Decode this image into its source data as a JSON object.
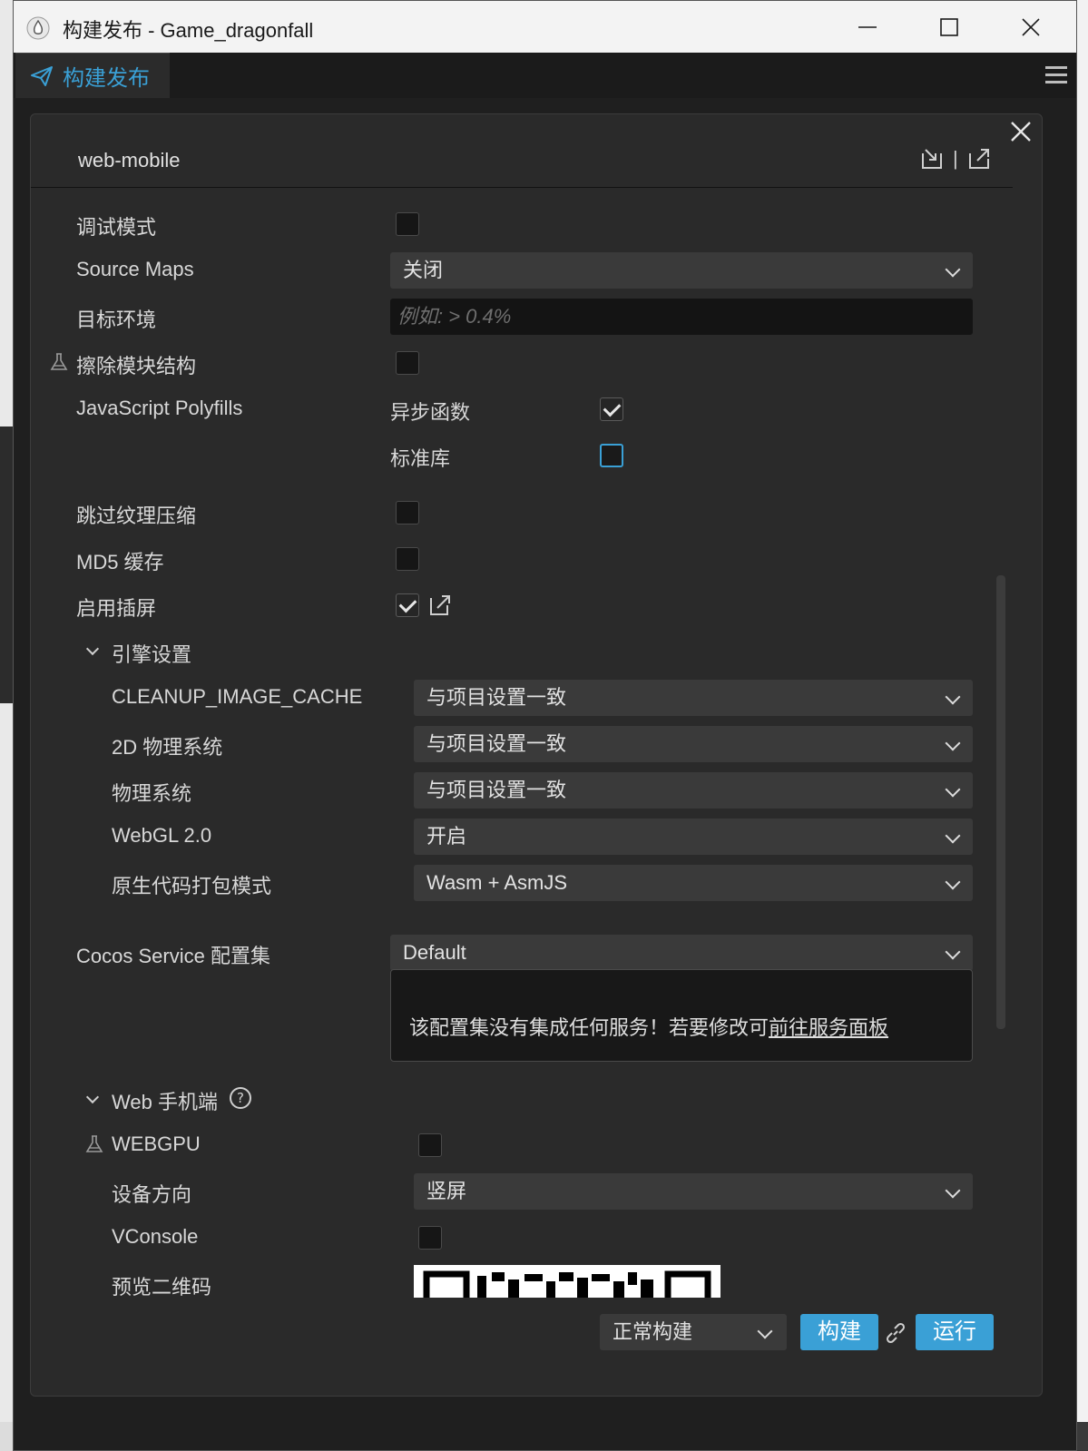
{
  "window": {
    "title": "构建发布 - Game_dragonfall"
  },
  "tab": {
    "label": "构建发布"
  },
  "panel": {
    "platform": "web-mobile",
    "header_separator": "|"
  },
  "options": {
    "debug_mode": {
      "label": "调试模式",
      "checked": false
    },
    "source_maps": {
      "label": "Source Maps",
      "value": "关闭"
    },
    "target_env": {
      "label": "目标环境",
      "placeholder": "例如: > 0.4%"
    },
    "erase_modules": {
      "label": "擦除模块结构",
      "checked": false
    },
    "polyfills": {
      "label": "JavaScript Polyfills",
      "async_label": "异步函数",
      "async_checked": true,
      "stdlib_label": "标准库",
      "stdlib_checked": false
    },
    "skip_texture": {
      "label": "跳过纹理压缩",
      "checked": false
    },
    "md5_cache": {
      "label": "MD5 缓存",
      "checked": false
    },
    "splash": {
      "label": "启用插屏",
      "checked": true
    }
  },
  "engine_settings": {
    "title": "引擎设置",
    "rows": [
      {
        "label": "CLEANUP_IMAGE_CACHE",
        "value": "与项目设置一致"
      },
      {
        "label": "2D 物理系统",
        "value": "与项目设置一致"
      },
      {
        "label": "物理系统",
        "value": "与项目设置一致"
      },
      {
        "label": "WebGL 2.0",
        "value": "开启"
      },
      {
        "label": "原生代码打包模式",
        "value": "Wasm + AsmJS"
      }
    ]
  },
  "cocos_service": {
    "label": "Cocos Service 配置集",
    "value": "Default",
    "message": "该配置集没有集成任何服务！若要修改可",
    "link": "前往服务面板"
  },
  "web_mobile": {
    "title": "Web 手机端",
    "help": "?",
    "webgpu": {
      "label": "WEBGPU",
      "checked": false
    },
    "orientation": {
      "label": "设备方向",
      "value": "竖屏"
    },
    "vconsole": {
      "label": "VConsole",
      "checked": false
    },
    "qr": {
      "label": "预览二维码"
    }
  },
  "footer": {
    "mode": "正常构建",
    "build": "构建",
    "run": "运行"
  },
  "colors": {
    "accent": "#3aa0d6",
    "panel_bg": "#2a2a2a",
    "field_bg": "#3a3a3a"
  }
}
